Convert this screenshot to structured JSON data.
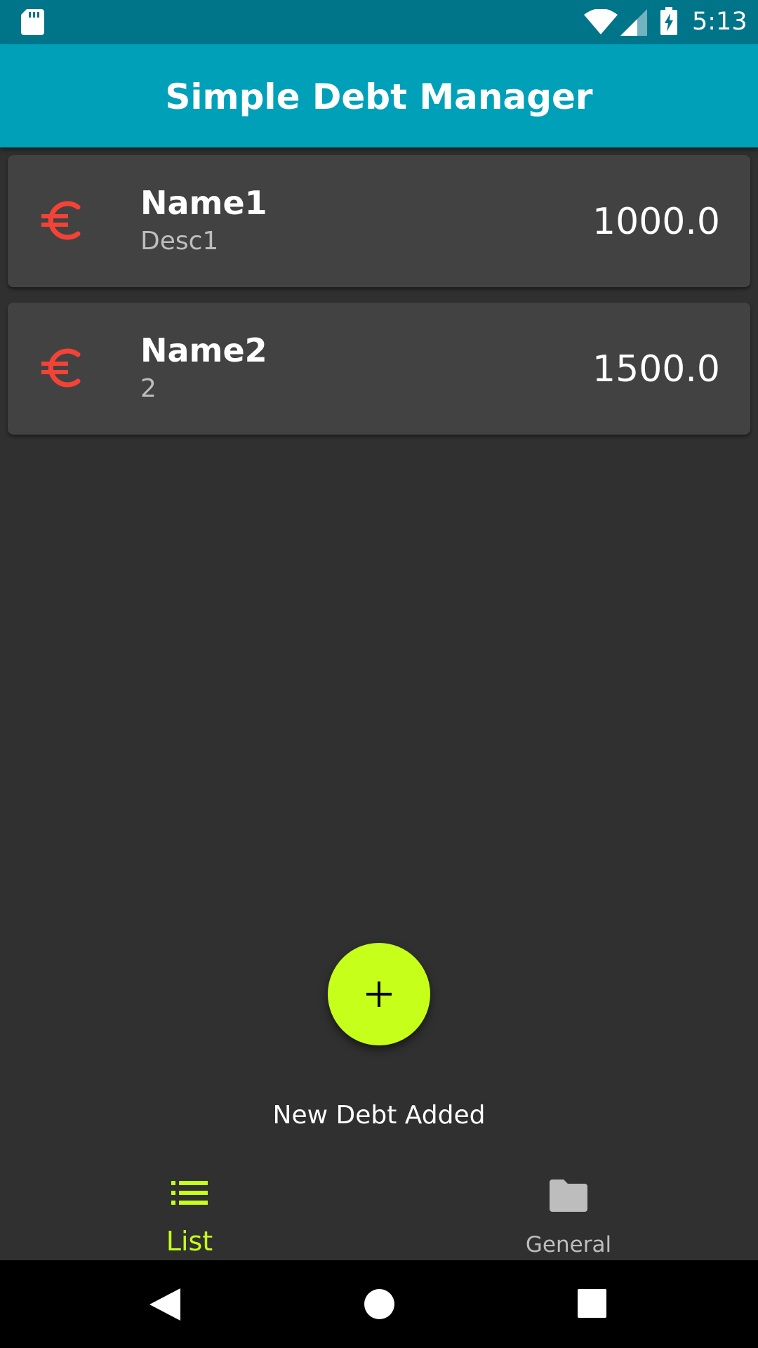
{
  "status_bar": {
    "time": "5:13",
    "icons": [
      "sd-card-icon",
      "wifi-icon",
      "cell-signal-icon",
      "battery-charging-icon"
    ]
  },
  "app_bar": {
    "title": "Simple Debt Manager"
  },
  "debts": [
    {
      "icon": "euro-icon",
      "name": "Name1",
      "description": "Desc1",
      "amount": "1000.0"
    },
    {
      "icon": "euro-icon",
      "name": "Name2",
      "description": "2",
      "amount": "1500.0"
    }
  ],
  "fab": {
    "icon": "plus-icon"
  },
  "snackbar": {
    "message": "New Debt Added"
  },
  "bottom_nav": {
    "items": [
      {
        "label": "List",
        "icon": "list-icon",
        "selected": true
      },
      {
        "label": "General",
        "icon": "folder-icon",
        "selected": false
      }
    ]
  },
  "system_nav": {
    "buttons": [
      "back-icon",
      "home-icon",
      "recents-icon"
    ]
  },
  "colors": {
    "status_bar": "#00758a",
    "app_bar": "#00a0b9",
    "background": "#303030",
    "card": "#424242",
    "accent": "#c6ff1a",
    "euro": "#f44336",
    "secondary_text": "#bdbdbd"
  }
}
